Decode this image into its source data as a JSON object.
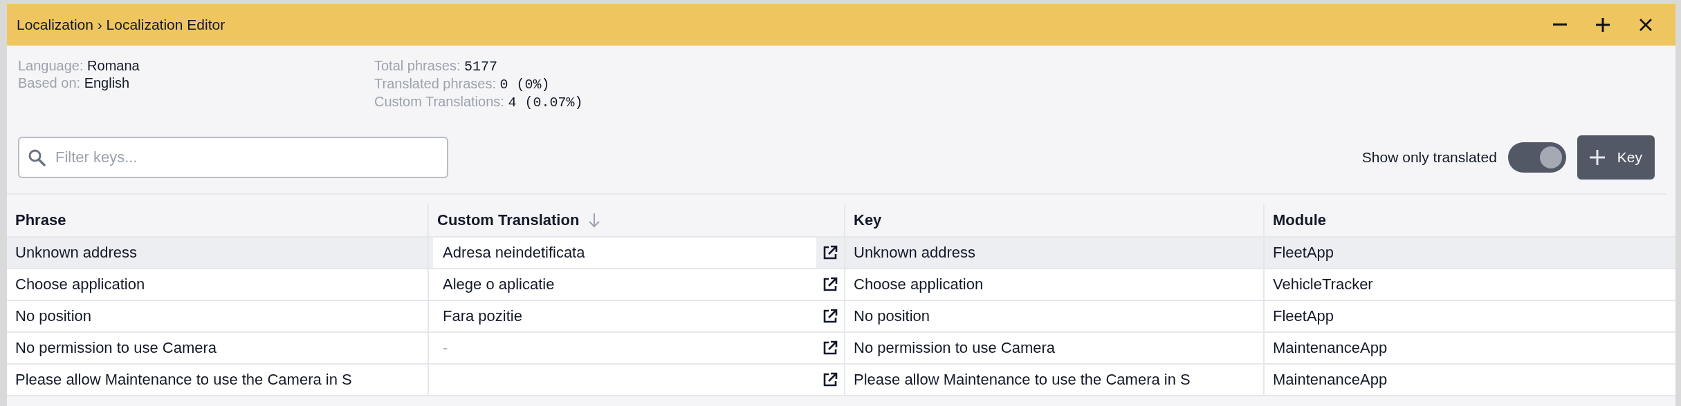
{
  "window": {
    "title": "Localization › Localization Editor"
  },
  "info": {
    "left": [
      {
        "label": "Language:",
        "value": "Romana"
      },
      {
        "label": "Based on:",
        "value": "English"
      }
    ],
    "right": [
      {
        "label": "Total phrases:",
        "value": "5177"
      },
      {
        "label": "Translated phrases:",
        "value": "0 (0%)"
      },
      {
        "label": "Custom Translations:",
        "value": "4 (0.07%)"
      }
    ]
  },
  "filter": {
    "placeholder": "Filter keys..."
  },
  "toggle": {
    "label": "Show only translated",
    "on": true
  },
  "add_button": {
    "label": "Key"
  },
  "table": {
    "columns": [
      {
        "label": "Phrase",
        "sorted": false
      },
      {
        "label": "Custom Translation",
        "sorted": true
      },
      {
        "label": "Key",
        "sorted": false
      },
      {
        "label": "Module",
        "sorted": false
      }
    ],
    "rows": [
      {
        "phrase": "Unknown address",
        "translation": "Adresa neindetificata",
        "key": "Unknown address",
        "module": "FleetApp",
        "selected": true
      },
      {
        "phrase": "Choose application",
        "translation": "Alege o aplicatie",
        "key": "Choose application",
        "module": "VehicleTracker",
        "selected": false
      },
      {
        "phrase": "No position",
        "translation": "Fara pozitie",
        "key": "No position",
        "module": "FleetApp",
        "selected": false
      },
      {
        "phrase": "No permission to use Camera",
        "translation": "-",
        "key": "No permission to use Camera",
        "module": "MaintenanceApp",
        "selected": false
      },
      {
        "phrase": "Please allow Maintenance to use the Camera in S",
        "key": "Please allow Maintenance to use the Camera in S",
        "module": "MaintenanceApp",
        "selected": false
      }
    ]
  }
}
